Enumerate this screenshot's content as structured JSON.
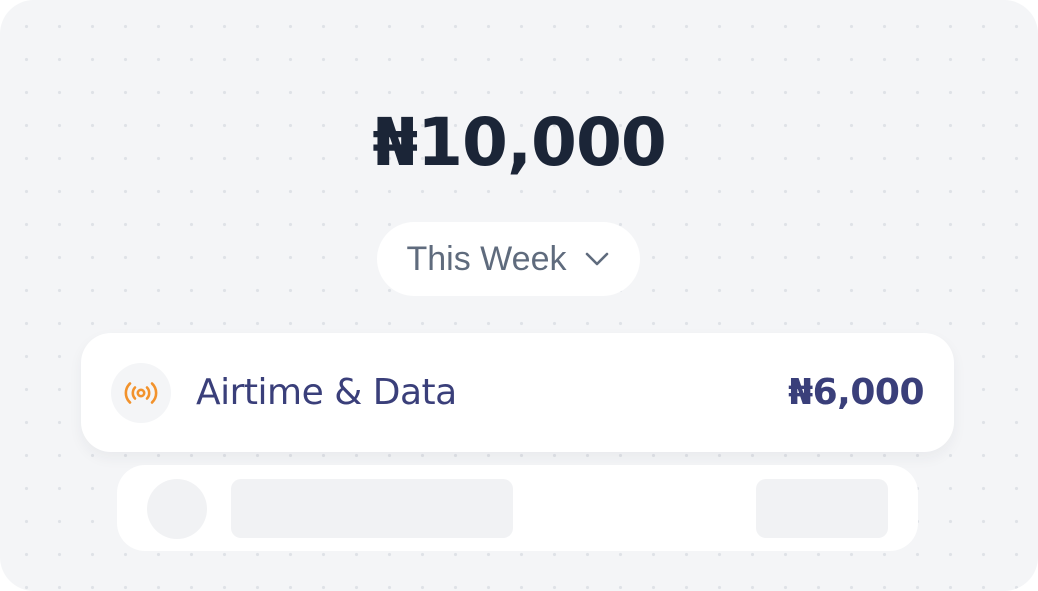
{
  "summary": {
    "total_amount": "₦10,000",
    "period_selector": {
      "label": "This Week",
      "icon": "chevron-down-icon"
    }
  },
  "transactions": [
    {
      "icon": "broadcast-signal-icon",
      "icon_color": "#f2922c",
      "label": "Airtime & Data",
      "amount": "₦6,000"
    }
  ],
  "colors": {
    "card_background": "#f4f5f7",
    "primary_text": "#1b2537",
    "accent_text": "#3a3f7a",
    "muted_text": "#5f6b7d"
  }
}
